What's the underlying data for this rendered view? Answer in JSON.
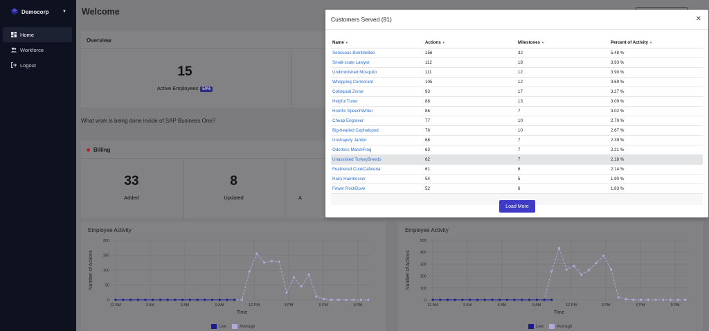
{
  "sidebar": {
    "brand": "Democorp",
    "items": [
      {
        "label": "Home"
      },
      {
        "label": "Workforce"
      },
      {
        "label": "Logout"
      }
    ]
  },
  "main": {
    "title": "Welcome",
    "overview": {
      "title": "Overview",
      "active_count": "15",
      "active_label": "Active Employees",
      "active_pct": "50%"
    },
    "question": "What work is being done inside of SAP Business One?",
    "billing": {
      "title": "Billing",
      "stats": [
        {
          "num": "33",
          "label": "Added"
        },
        {
          "num": "8",
          "label": "Updated"
        },
        {
          "label": "A"
        }
      ]
    },
    "charts": [
      {
        "title": "Employee Activity",
        "ylabel": "Number of Actions",
        "xlabel": "Time",
        "yticks": [
          "0",
          "50",
          "100",
          "150",
          "200"
        ],
        "xticks": [
          "12 AM",
          "3 AM",
          "6 AM",
          "9 AM",
          "12 PM",
          "3 PM",
          "6 PM",
          "9 PM"
        ],
        "legend": [
          "Live",
          "Average"
        ]
      },
      {
        "title": "Employee Activity",
        "ylabel": "Number of Actions",
        "xlabel": "Time",
        "yticks": [
          "0",
          "100",
          "200",
          "300",
          "400",
          "500"
        ],
        "xticks": [
          "12 AM",
          "3 AM",
          "6 AM",
          "9 AM",
          "12 PM",
          "3 PM",
          "6 PM",
          "9 PM"
        ],
        "legend": [
          "Live",
          "Average"
        ]
      }
    ]
  },
  "chart_data": [
    {
      "type": "line",
      "title": "Employee Activity",
      "xlabel": "Time",
      "ylabel": "Number of Actions",
      "ylim": [
        0,
        200
      ],
      "x_ticks": [
        "12 AM",
        "3 AM",
        "6 AM",
        "9 AM",
        "12 PM",
        "3 PM",
        "6 PM",
        "9 PM"
      ],
      "series": [
        {
          "name": "Average",
          "values": [
            0,
            0,
            0,
            0,
            0,
            0,
            0,
            0,
            0,
            0,
            0,
            0,
            0,
            0,
            0,
            0,
            0,
            0,
            95,
            155,
            125,
            130,
            128,
            25,
            75,
            45,
            85,
            12,
            3,
            0,
            0,
            0,
            0,
            0,
            0
          ]
        },
        {
          "name": "Live",
          "values": [
            0,
            0,
            0,
            0,
            0,
            0,
            0,
            0,
            0,
            0,
            0,
            0,
            0,
            0,
            0,
            0,
            0
          ]
        }
      ]
    },
    {
      "type": "line",
      "title": "Employee Activity",
      "xlabel": "Time",
      "ylabel": "Number of Actions",
      "ylim": [
        0,
        500
      ],
      "x_ticks": [
        "12 AM",
        "3 AM",
        "6 AM",
        "9 AM",
        "12 PM",
        "3 PM",
        "6 PM",
        "9 PM"
      ],
      "series": [
        {
          "name": "Average",
          "values": [
            0,
            0,
            0,
            0,
            0,
            0,
            0,
            0,
            0,
            0,
            0,
            0,
            0,
            0,
            0,
            0,
            240,
            435,
            255,
            285,
            210,
            250,
            310,
            370,
            255,
            20,
            5,
            0,
            0,
            0,
            0,
            0,
            0,
            0,
            0
          ]
        },
        {
          "name": "Live",
          "values": [
            0,
            0,
            0,
            0,
            0,
            0,
            0,
            0,
            0,
            0,
            0,
            0,
            0,
            0,
            0,
            0,
            0
          ]
        }
      ]
    }
  ],
  "modal": {
    "title": "Customers Served (81)",
    "columns": [
      "Name",
      "Actions",
      "Milestones",
      "Percent of Activity"
    ],
    "rows": [
      [
        "Sensuous BumbleBee",
        "156",
        "32",
        "5.48 %"
      ],
      [
        "Small-scale Lawyer",
        "112",
        "18",
        "3.93 %"
      ],
      [
        "Undiminished Mosquito",
        "111",
        "12",
        "3.90 %"
      ],
      [
        "Whopping Cormorant",
        "105",
        "12",
        "3.69 %"
      ],
      [
        "Colloquial Zorse",
        "93",
        "17",
        "3.27 %"
      ],
      [
        "Helpful Tuner",
        "88",
        "13",
        "3.09 %"
      ],
      [
        "Horrific SpeechWriter",
        "86",
        "7",
        "3.02 %"
      ],
      [
        "Cheap Engraver",
        "77",
        "10",
        "2.70 %"
      ],
      [
        "Big-headed Cephalopod",
        "76",
        "10",
        "2.67 %"
      ],
      [
        "Unshapely Janitor",
        "68",
        "7",
        "2.39 %"
      ],
      [
        "Odorless MarshFrog",
        "63",
        "7",
        "2.21 %"
      ],
      [
        "Unassisted TurkeyBreeds",
        "62",
        "7",
        "2.18 %"
      ],
      [
        "Feathered CookCafeteria",
        "61",
        "6",
        "2.14 %"
      ],
      [
        "Hairy Hairdresser",
        "54",
        "5",
        "1.90 %"
      ],
      [
        "Fewer RockDove",
        "52",
        "6",
        "1.83 %"
      ]
    ],
    "highlight_index": 11,
    "load_more": "Load More"
  },
  "colors": {
    "accent": "#3e3bc6",
    "link": "#2b6fd6",
    "sidebar": "#0e1220",
    "live": "#1c1a8a",
    "average": "#aeaadd"
  }
}
